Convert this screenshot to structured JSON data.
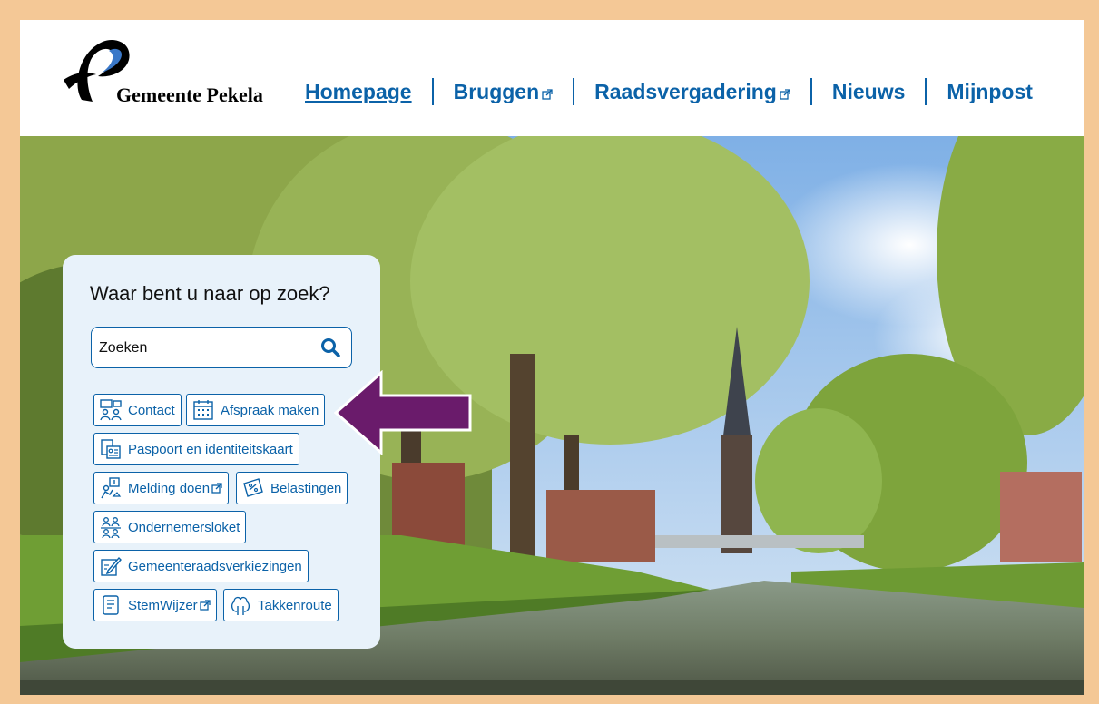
{
  "header": {
    "logo_text": "Gemeente Pekela",
    "nav": [
      {
        "label": "Homepage",
        "active": true,
        "external": false
      },
      {
        "label": "Bruggen",
        "active": false,
        "external": true
      },
      {
        "label": "Raadsvergadering",
        "active": false,
        "external": true
      },
      {
        "label": "Nieuws",
        "active": false,
        "external": false
      },
      {
        "label": "Mijnpost",
        "active": false,
        "external": false
      }
    ]
  },
  "search_panel": {
    "title": "Waar bent u naar op zoek?",
    "placeholder": "Zoeken",
    "quick_links": [
      {
        "label": "Contact",
        "icon": "contact-icon",
        "external": false
      },
      {
        "label": "Afspraak maken",
        "icon": "calendar-icon",
        "external": false
      },
      {
        "label": "Paspoort en identiteitskaart",
        "icon": "id-card-icon",
        "external": false
      },
      {
        "label": "Melding doen",
        "icon": "report-icon",
        "external": true
      },
      {
        "label": "Belastingen",
        "icon": "tax-icon",
        "external": false
      },
      {
        "label": "Ondernemersloket",
        "icon": "entrepreneurs-icon",
        "external": false
      },
      {
        "label": "Gemeenteraadsverkiezingen",
        "icon": "vote-icon",
        "external": false
      },
      {
        "label": "StemWijzer",
        "icon": "voting-guide-icon",
        "external": true
      },
      {
        "label": "Takkenroute",
        "icon": "tree-icon",
        "external": false
      }
    ]
  },
  "colors": {
    "brand_blue": "#0b62a8",
    "frame": "#f4c896",
    "panel_bg": "#e8f2fa",
    "arrow": "#6a1b6b"
  }
}
